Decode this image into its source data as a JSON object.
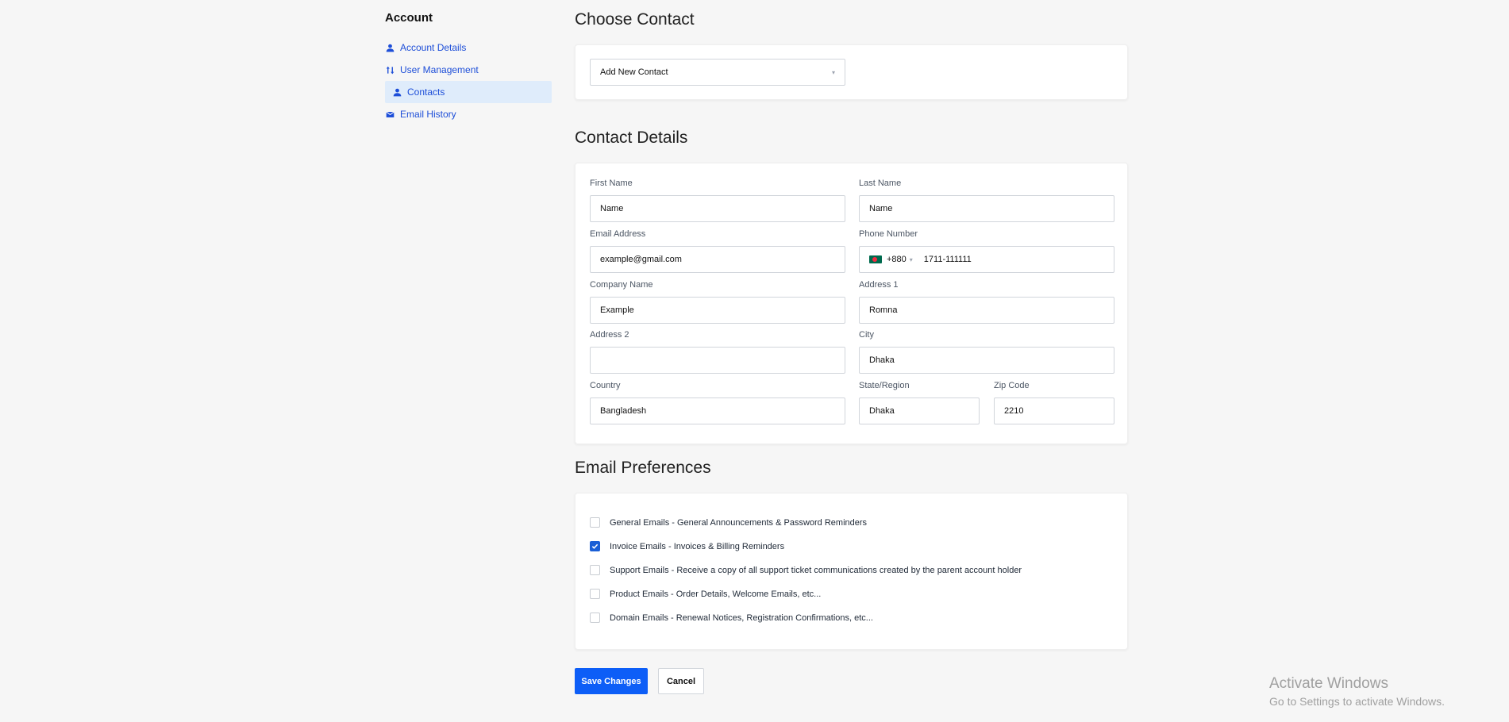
{
  "sidebar": {
    "title": "Account",
    "items": [
      {
        "label": "Account Details",
        "icon": "user-icon"
      },
      {
        "label": "User Management",
        "icon": "swap-icon"
      },
      {
        "label": "Contacts",
        "icon": "user-icon",
        "active": true
      },
      {
        "label": "Email History",
        "icon": "envelope-icon"
      }
    ]
  },
  "choose_contact": {
    "title": "Choose Contact",
    "select_value": "Add New Contact"
  },
  "contact_details": {
    "title": "Contact Details",
    "first_name": {
      "label": "First Name",
      "value": "Name"
    },
    "last_name": {
      "label": "Last Name",
      "value": "Name"
    },
    "email": {
      "label": "Email Address",
      "value": "example@gmail.com"
    },
    "phone": {
      "label": "Phone Number",
      "code": "+880",
      "value": "1711-111111"
    },
    "company": {
      "label": "Company Name",
      "value": "Example"
    },
    "address1": {
      "label": "Address 1",
      "value": "Romna"
    },
    "address2": {
      "label": "Address 2",
      "value": ""
    },
    "city": {
      "label": "City",
      "value": "Dhaka"
    },
    "country": {
      "label": "Country",
      "value": "Bangladesh"
    },
    "state": {
      "label": "State/Region",
      "value": "Dhaka"
    },
    "zip": {
      "label": "Zip Code",
      "value": "2210"
    }
  },
  "email_preferences": {
    "title": "Email Preferences",
    "items": [
      {
        "label": "General Emails - General Announcements & Password Reminders",
        "checked": false
      },
      {
        "label": "Invoice Emails - Invoices & Billing Reminders",
        "checked": true
      },
      {
        "label": "Support Emails - Receive a copy of all support ticket communications created by the parent account holder",
        "checked": false
      },
      {
        "label": "Product Emails - Order Details, Welcome Emails, etc...",
        "checked": false
      },
      {
        "label": "Domain Emails - Renewal Notices, Registration Confirmations, etc...",
        "checked": false
      }
    ]
  },
  "actions": {
    "save_label": "Save Changes",
    "cancel_label": "Cancel"
  },
  "watermark": {
    "line1": "Activate Windows",
    "line2": "Go to Settings to activate Windows."
  },
  "colors": {
    "accent": "#0d5ef7",
    "link": "#1d4ed8",
    "active_bg": "#dfecfb"
  }
}
